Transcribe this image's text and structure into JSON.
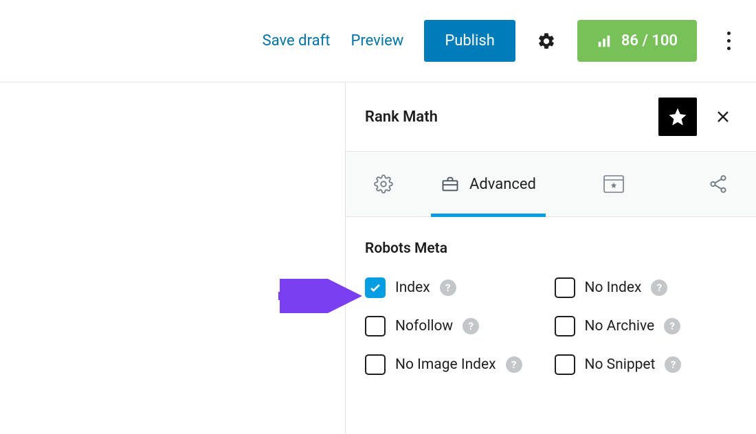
{
  "toolbar": {
    "save_draft": "Save draft",
    "preview": "Preview",
    "publish": "Publish",
    "score": "86 / 100"
  },
  "sidebar": {
    "title": "Rank Math",
    "tab_advanced": "Advanced",
    "robots_section_title": "Robots Meta",
    "options": [
      {
        "label": "Index",
        "checked": true
      },
      {
        "label": "No Index",
        "checked": false
      },
      {
        "label": "Nofollow",
        "checked": false
      },
      {
        "label": "No Archive",
        "checked": false
      },
      {
        "label": "No Image Index",
        "checked": false
      },
      {
        "label": "No Snippet",
        "checked": false
      }
    ]
  },
  "colors": {
    "link": "#0073aa",
    "primary_btn": "#007cba",
    "score_badge": "#77c158",
    "accent": "#069de3",
    "annotation": "#7b3ff2"
  }
}
